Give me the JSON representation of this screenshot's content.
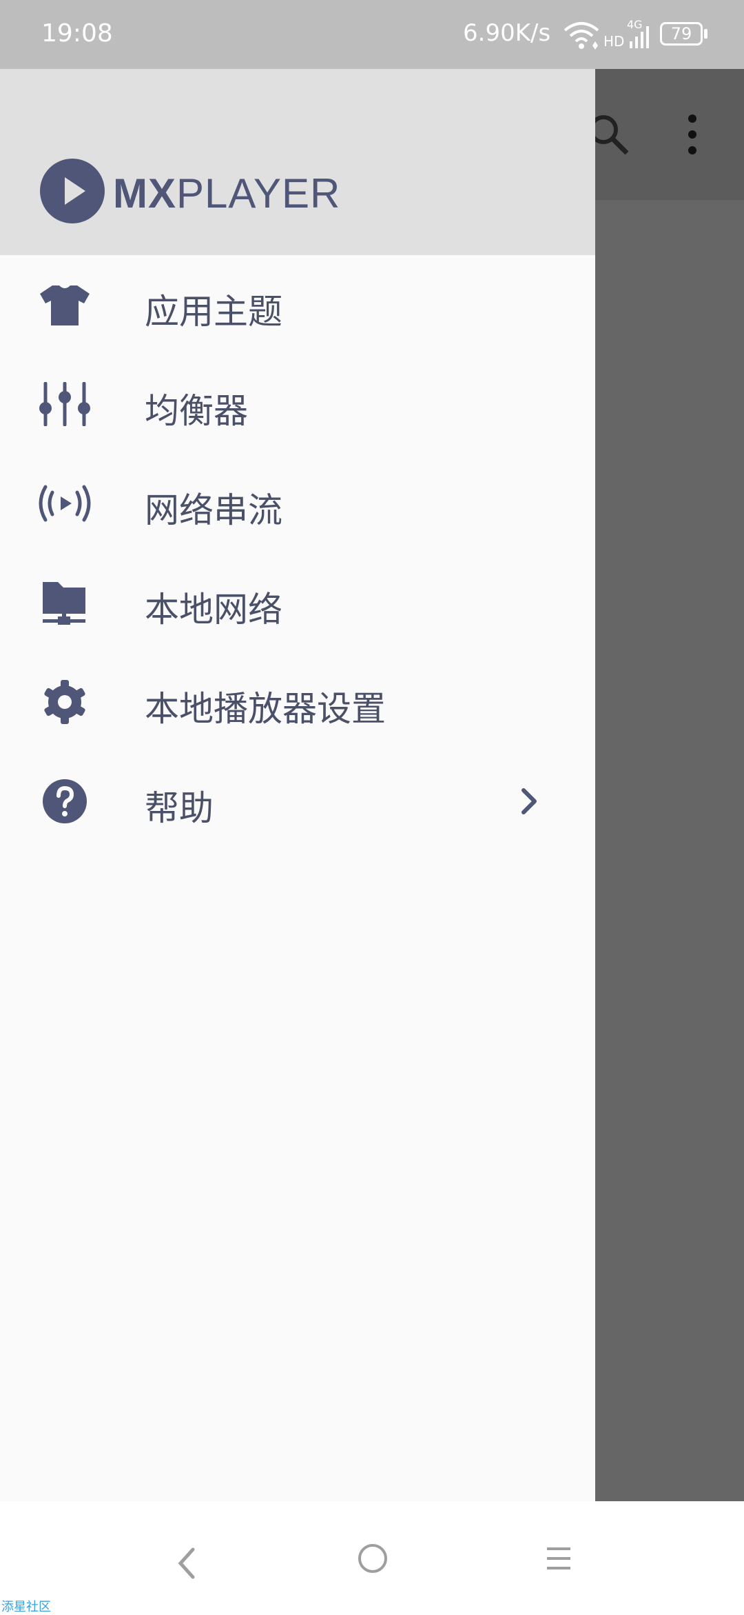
{
  "status_bar": {
    "time": "19:08",
    "net_speed": "6.90K/s",
    "hd_label": "HD",
    "network_type": "4G",
    "battery": "79"
  },
  "drawer": {
    "logo": {
      "mx": "MX",
      "player": "PLAYER"
    },
    "items": [
      {
        "label": "应用主题",
        "icon": "tshirt-icon"
      },
      {
        "label": "均衡器",
        "icon": "equalizer-icon"
      },
      {
        "label": "网络串流",
        "icon": "broadcast-icon"
      },
      {
        "label": "本地网络",
        "icon": "network-folder-icon"
      },
      {
        "label": "本地播放器设置",
        "icon": "gear-icon"
      },
      {
        "label": "帮助",
        "icon": "help-icon",
        "has_submenu": true
      }
    ]
  },
  "watermark": "添星社区",
  "colors": {
    "accent": "#4f5677",
    "drawer_bg": "#fafafa",
    "header_bg": "#e0e0e0",
    "status_bar": "#bdbdbd",
    "scrim": "#666666"
  }
}
